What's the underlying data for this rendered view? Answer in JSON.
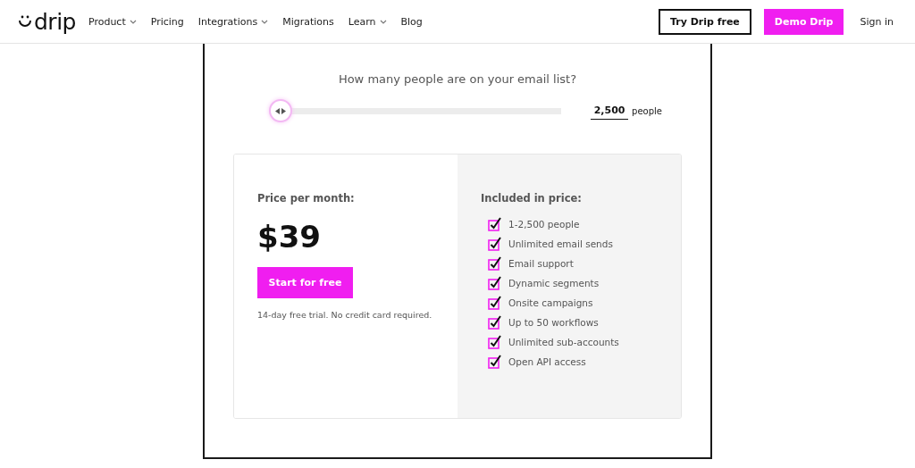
{
  "header": {
    "logo": "drip",
    "nav": [
      {
        "label": "Product",
        "dropdown": true
      },
      {
        "label": "Pricing",
        "dropdown": false
      },
      {
        "label": "Integrations",
        "dropdown": true
      },
      {
        "label": "Migrations",
        "dropdown": false
      },
      {
        "label": "Learn",
        "dropdown": true
      },
      {
        "label": "Blog",
        "dropdown": false
      }
    ],
    "actions": [
      {
        "label": "Try Drip free",
        "kind": "outline"
      },
      {
        "label": "Demo Drip",
        "kind": "filled"
      },
      {
        "label": "Sign in",
        "kind": "link"
      }
    ]
  },
  "calculator": {
    "question": "How many people are on your email list?",
    "slider": {
      "level": 0
    },
    "count": {
      "value": "2,500",
      "unit": "people"
    }
  },
  "plan": {
    "price_label": "Price per month:",
    "price": "$39",
    "cta": "Start for free",
    "note": "14-day free trial. No credit card required.",
    "included_title": "Included in price:",
    "features": [
      {
        "label": "1-2,500 people",
        "checked": true
      },
      {
        "label": "Unlimited email sends",
        "checked": true
      },
      {
        "label": "Email support",
        "checked": true
      },
      {
        "label": "Dynamic segments",
        "checked": true
      },
      {
        "label": "Onsite campaigns",
        "checked": true
      },
      {
        "label": "Up to 50 workflows",
        "checked": true
      },
      {
        "label": "Unlimited sub-accounts",
        "checked": true
      },
      {
        "label": "Open API access",
        "checked": true
      }
    ]
  }
}
